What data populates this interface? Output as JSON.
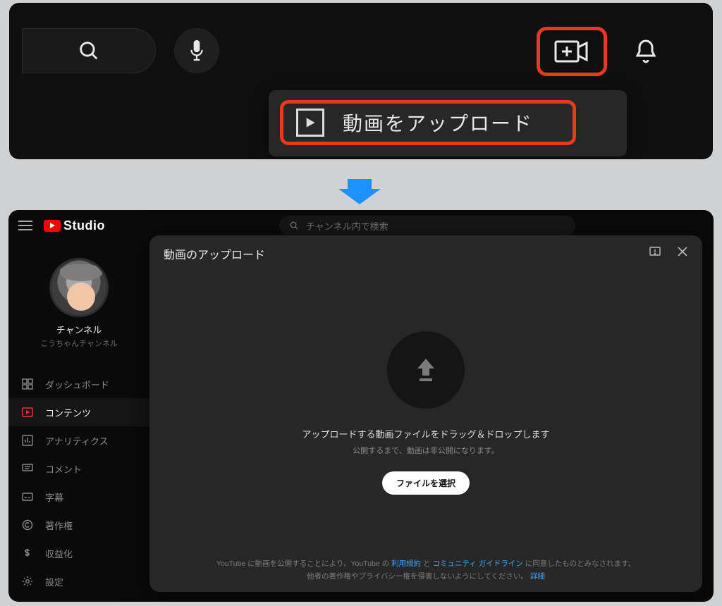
{
  "top": {
    "dropdown": {
      "upload_label": "動画をアップロード"
    }
  },
  "arrow": {},
  "studio": {
    "logo_text": "Studio",
    "search_placeholder": "チャンネル内で検索",
    "channel_label": "チャンネル",
    "channel_name": "こうちゃんチャンネル",
    "nav": {
      "dashboard": "ダッシュボード",
      "content": "コンテンツ",
      "analytics": "アナリティクス",
      "comments": "コメント",
      "subtitles": "字幕",
      "copyright": "著作権",
      "monetize": "収益化",
      "settings": "設定"
    }
  },
  "modal": {
    "title": "動画のアップロード",
    "dz_main": "アップロードする動画ファイルをドラッグ＆ドロップします",
    "dz_sub": "公開するまで、動画は非公開になります。",
    "file_button": "ファイルを選択",
    "legal1a": "YouTube に動画を公開することにより、YouTube の ",
    "legal1_tos": "利用規約",
    "legal1b": " と ",
    "legal1_cg": "コミュニティ ガイドライン",
    "legal1c": " に同意したものとみなされます。",
    "legal2a": "他者の著作権やプライバシー権を侵害しないようにしてください。",
    "legal2_more": "詳細"
  }
}
